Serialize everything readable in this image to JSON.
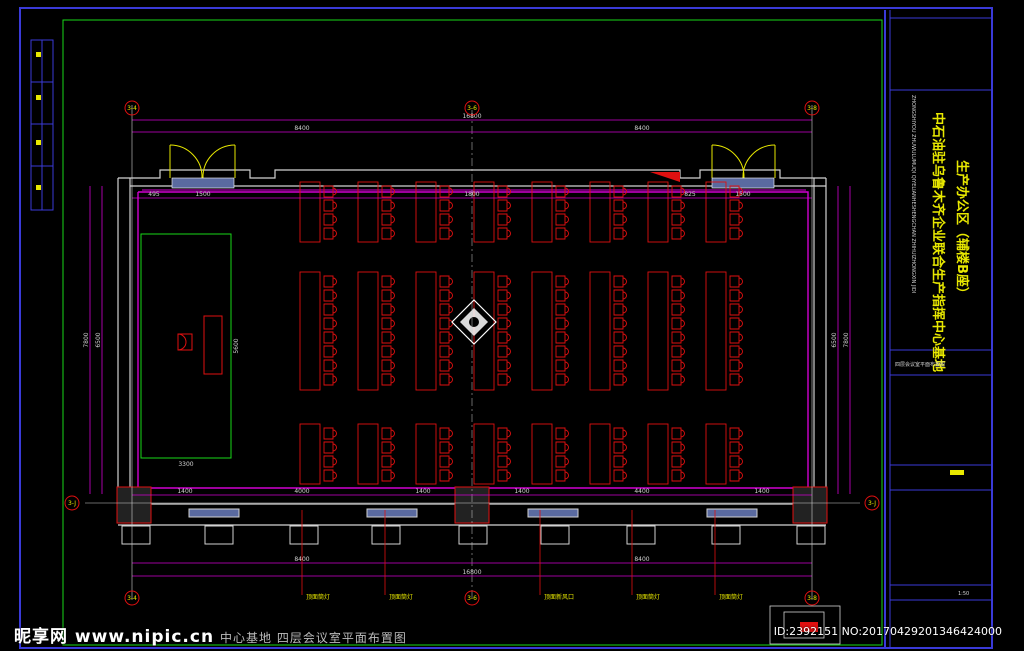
{
  "drawing": {
    "title_vertical": "中石油驻乌鲁木齐企业联合生产指挥中心基地",
    "subtitle_vertical": "生产办公区（辅楼B座）",
    "small_text_vertical_1": "ZHONGSHIYOU ZHUWULUMUQI QIYELIANHESHENGCHAN ZHIHUIZHONGXIN JIDI",
    "sheet_name": "四层会议室平面布置图",
    "scale_label": "1:50"
  },
  "grid": {
    "axis_left": "3-4",
    "axis_mid": "3-6",
    "axis_right": "3-8",
    "axis_row_bottom": "3-J"
  },
  "dimensions": {
    "total": "16800",
    "half_left": "8400",
    "half_right": "8400",
    "door_w": "1500",
    "side_left": "495",
    "side_right": "825",
    "seg_1400a": "1400",
    "seg_4000": "4000",
    "seg_1400b": "1400",
    "seg_4400": "4400",
    "seg_1400c": "1400",
    "height_total": "7800",
    "height_inner": "6500",
    "podium_w": "3300",
    "podium_h": "5600",
    "gap_1800": "1800"
  },
  "annotations": {
    "lamp_1": "顶面筒灯",
    "lamp_2": "顶面筒灯",
    "vent": "顶面新风口",
    "lamp_3": "顶面筒灯",
    "lamp_4": "顶面筒灯"
  },
  "watermark": {
    "brand": "昵享网 www.nipic.cn",
    "sub": "中心基地 四层会议室平面布置图",
    "id": "ID:2392151 NO:20170429201346424000"
  },
  "colors": {
    "frame": "#3a3ad8",
    "border_green": "#19d919",
    "wall": "#d2d2d2",
    "magenta": "#d100d1",
    "furniture": "#e01010",
    "yellow": "#e8e800"
  }
}
